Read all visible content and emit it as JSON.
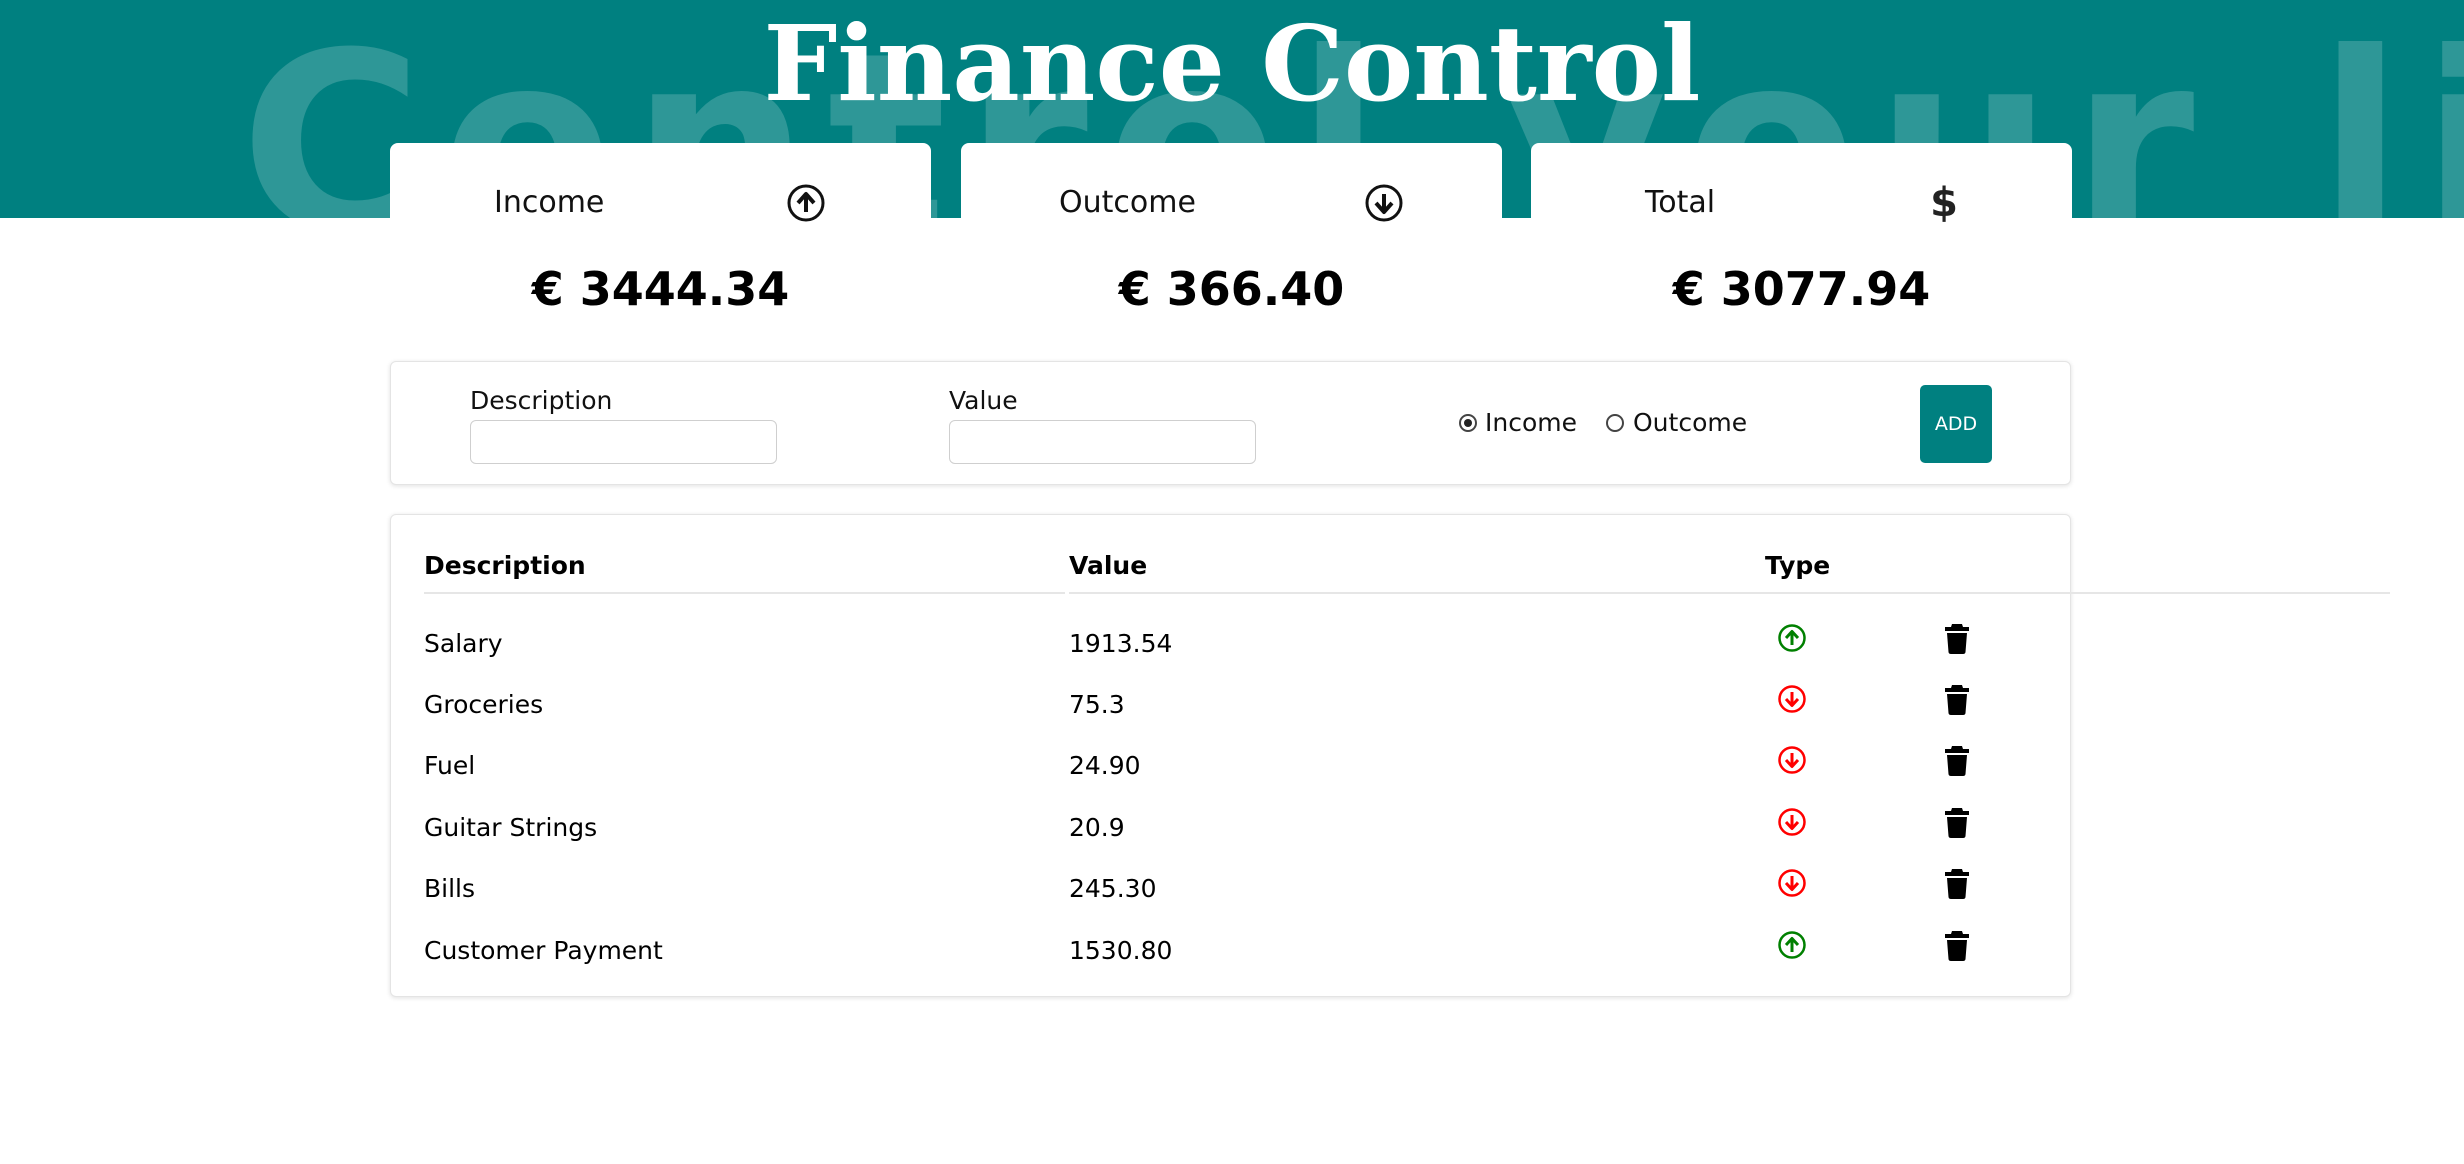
{
  "header": {
    "title": "Finance Control",
    "background_text": "Control your life",
    "color": "#008080"
  },
  "cards": {
    "income": {
      "label": "Income",
      "icon": "arrow-circle-up-icon",
      "value": "€ 3444.34"
    },
    "outcome": {
      "label": "Outcome",
      "icon": "arrow-circle-down-icon",
      "value": "€ 366.40"
    },
    "total": {
      "label": "Total",
      "icon": "dollar-icon",
      "value": "€ 3077.94"
    }
  },
  "form": {
    "description_label": "Description",
    "description_value": "",
    "value_label": "Value",
    "value_value": "",
    "radio_income_label": "Income",
    "radio_outcome_label": "Outcome",
    "selected_type": "income",
    "add_label": "ADD"
  },
  "table": {
    "headers": {
      "description": "Description",
      "value": "Value",
      "type": "Type"
    },
    "rows": [
      {
        "description": "Salary",
        "value": "1913.54",
        "type": "income"
      },
      {
        "description": "Groceries",
        "value": "75.3",
        "type": "outcome"
      },
      {
        "description": "Fuel",
        "value": "24.90",
        "type": "outcome"
      },
      {
        "description": "Guitar Strings",
        "value": "20.9",
        "type": "outcome"
      },
      {
        "description": "Bills",
        "value": "245.30",
        "type": "outcome"
      },
      {
        "description": "Customer Payment",
        "value": "1530.80",
        "type": "income"
      }
    ]
  },
  "colors": {
    "income": "#008000",
    "outcome": "#ff0000",
    "accent": "#008080"
  }
}
